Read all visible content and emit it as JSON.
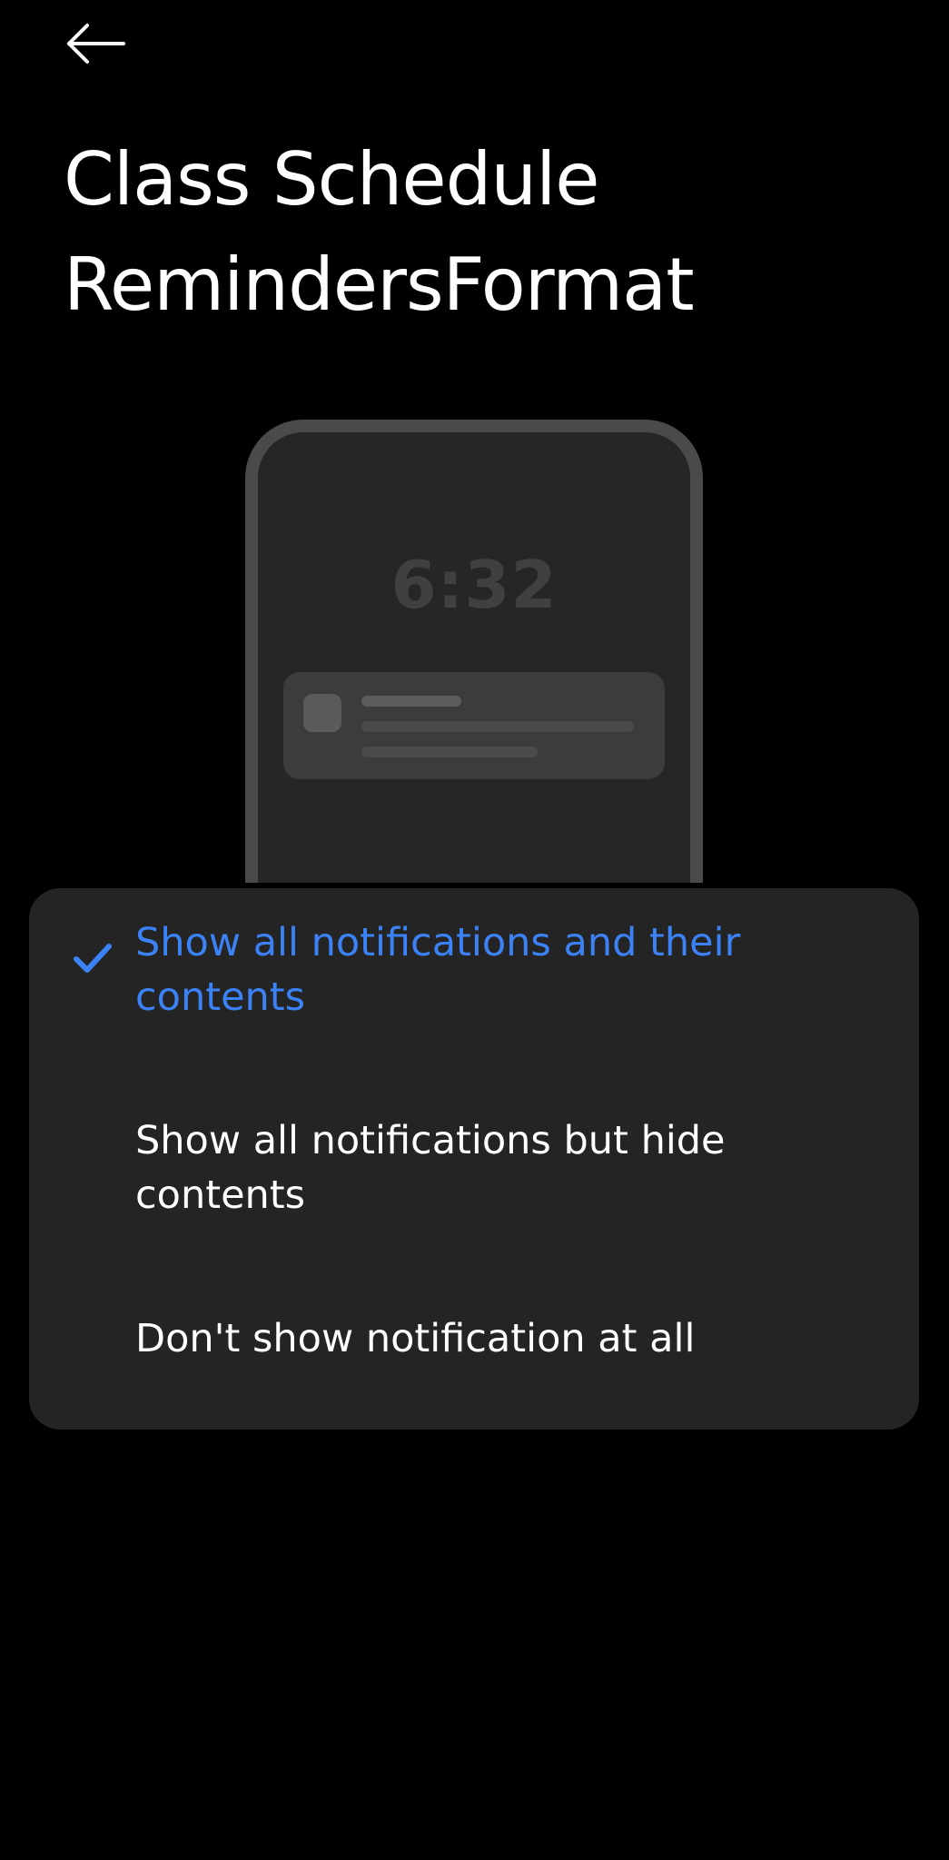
{
  "header": {
    "back_icon": "arrow-left-icon",
    "title_line1": "Class Schedule",
    "title_line2": "RemindersFormat"
  },
  "preview": {
    "clock_time": "6:32"
  },
  "options": {
    "selected_index": 0,
    "accent_color": "#3b82f6",
    "check_icon": "checkmark-icon",
    "items": [
      {
        "label": "Show all notifications and their contents",
        "selected": true
      },
      {
        "label": "Show all notifications but hide contents",
        "selected": false
      },
      {
        "label": "Don't show notification at all",
        "selected": false
      }
    ]
  }
}
